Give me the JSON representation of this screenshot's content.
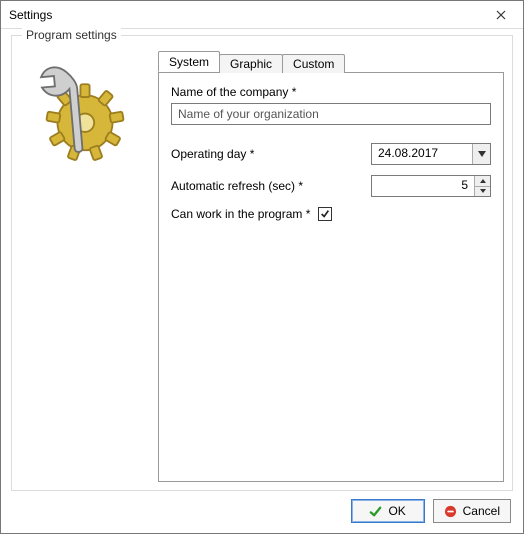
{
  "window": {
    "title": "Settings"
  },
  "group": {
    "title": "Program settings"
  },
  "tabs": [
    {
      "label": "System",
      "active": true
    },
    {
      "label": "Graphic",
      "active": false
    },
    {
      "label": "Custom",
      "active": false
    }
  ],
  "fields": {
    "company": {
      "label": "Name of the company *",
      "value": "Name of your organization"
    },
    "operating_day": {
      "label": "Operating day *",
      "value": "24.08.2017"
    },
    "auto_refresh": {
      "label": "Automatic refresh (sec) *",
      "value": "5"
    },
    "can_work": {
      "label": "Can work in the program *",
      "checked": true
    }
  },
  "buttons": {
    "ok": "OK",
    "cancel": "Cancel"
  }
}
